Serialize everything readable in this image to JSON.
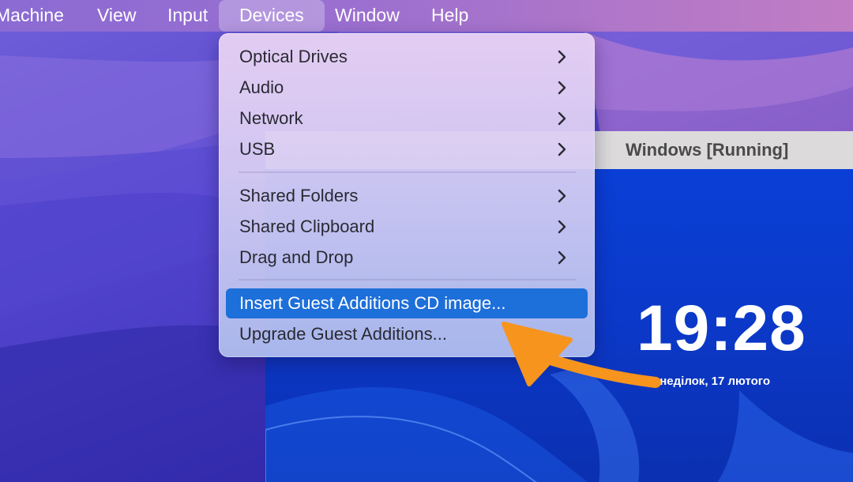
{
  "menubar": {
    "items": [
      "Machine",
      "View",
      "Input",
      "Devices",
      "Window",
      "Help"
    ],
    "active": "Devices"
  },
  "devices_menu": {
    "items": [
      {
        "label": "Optical Drives",
        "submenu": true
      },
      {
        "label": "Audio",
        "submenu": true
      },
      {
        "label": "Network",
        "submenu": true
      },
      {
        "label": "USB",
        "submenu": true
      },
      {
        "label": "Shared Folders",
        "submenu": true
      },
      {
        "label": "Shared Clipboard",
        "submenu": true
      },
      {
        "label": "Drag and Drop",
        "submenu": true
      },
      {
        "label": "Insert Guest Additions CD image...",
        "submenu": false,
        "highlighted": true
      },
      {
        "label": "Upgrade Guest Additions...",
        "submenu": false
      }
    ]
  },
  "vm_window": {
    "title": "Windows [Running]",
    "lock_screen": {
      "time": "19:28",
      "date": "понеділок, 17 лютого"
    }
  },
  "annotation": {
    "icon": "orange-arrow-icon",
    "color": "#f7941d"
  },
  "colors": {
    "highlight": "#1d6fd9",
    "menu_text": "#2a2a33",
    "vm_screen": "#0b39c9"
  }
}
